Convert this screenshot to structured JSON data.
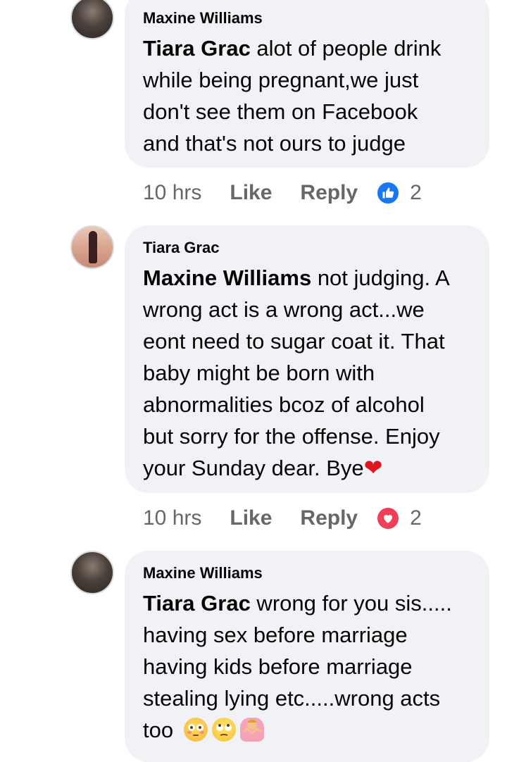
{
  "comments": [
    {
      "author": "Maxine Williams",
      "mention": "Tiara Grac",
      "lines": [
        " alot of people drink",
        "while being pregnant,we just",
        "don't see them on Facebook",
        "and that's not ours to judge"
      ],
      "time": "10 hrs",
      "like_label": "Like",
      "reply_label": "Reply",
      "reaction_type": "like",
      "reaction_count": "2"
    },
    {
      "author": "Tiara Grac",
      "mention": "Maxine Williams",
      "lines": [
        " not judging. A",
        "wrong act is a wrong act...we",
        "eont need to sugar coat it. That",
        "baby might be born with",
        "abnormalities bcoz of alcohol",
        "but sorry for the offense. Enjoy",
        "your Sunday dear. Bye"
      ],
      "trailing_emoji": "❤",
      "time": "10 hrs",
      "like_label": "Like",
      "reply_label": "Reply",
      "reaction_type": "love",
      "reaction_count": "2"
    },
    {
      "author": "Maxine Williams",
      "mention": "Tiara Grac",
      "lines": [
        " wrong for you sis.....",
        "having sex before marriage",
        "having kids before marriage",
        "stealing lying etc.....wrong acts",
        "too"
      ],
      "trailing_emojis": [
        "flushed-face-emoji",
        "face-with-rolling-eyes-emoji",
        "person-shrugging-emoji"
      ]
    }
  ],
  "colors": {
    "bubble": "#f0f2f5",
    "meta": "#65676b",
    "like_blue": "#1877f2",
    "love_red": "#f33e58"
  }
}
